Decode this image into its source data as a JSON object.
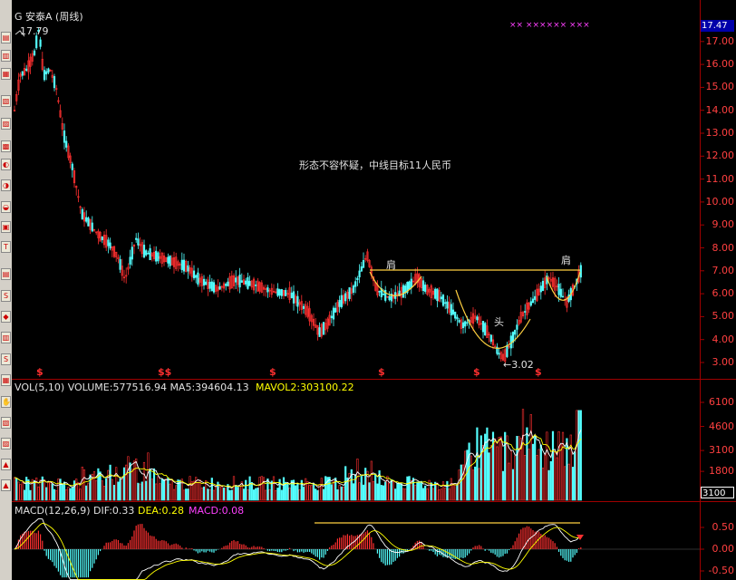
{
  "app": {
    "stock_title": "G 安泰A (周线)",
    "high_label": "17.79",
    "annotation": "形态不容怀疑，中线目标11人民币",
    "shoulder_left": "肩",
    "shoulder_right": "肩",
    "head_label": "头",
    "low_label": "←3.02",
    "dollar_marks": [
      "$",
      "$$",
      "$",
      "$",
      "$",
      "$"
    ],
    "top_marks": "×× ×××××× ×××",
    "current_price": "17.47",
    "vol_tag": "3100"
  },
  "price_axis": {
    "ticks": [
      "17.00",
      "16.00",
      "15.00",
      "14.00",
      "13.00",
      "12.00",
      "11.00",
      "10.00",
      "9.00",
      "8.00",
      "7.00",
      "6.00",
      "5.00",
      "4.00",
      "3.00"
    ],
    "values": [
      17,
      16,
      15,
      14,
      13,
      12,
      11,
      10,
      9,
      8,
      7,
      6,
      5,
      4,
      3
    ]
  },
  "volume": {
    "header": "VOL(5,10) VOLUME:577516.94 MA5:394604.13",
    "mavol2": "MAVOL2:303100.22",
    "ticks": [
      "6100",
      "4600",
      "3100",
      "1800"
    ],
    "values": [
      6100,
      4600,
      3100,
      1800
    ]
  },
  "macd": {
    "header": "MACD(12,26,9) DIF:0.33",
    "dea": "DEA:0.28",
    "macd_val": "MACD:0.08",
    "ticks": [
      "0.50",
      "0.00",
      "-0.50"
    ],
    "values": [
      0.5,
      0.0,
      -0.5
    ]
  },
  "colors": {
    "up": "#ff3030",
    "down": "#54ffff",
    "ma": "#ffff00",
    "neckline": "#ffd040",
    "macd_pos": "#ff3030",
    "macd_neg": "#54ffff"
  }
}
